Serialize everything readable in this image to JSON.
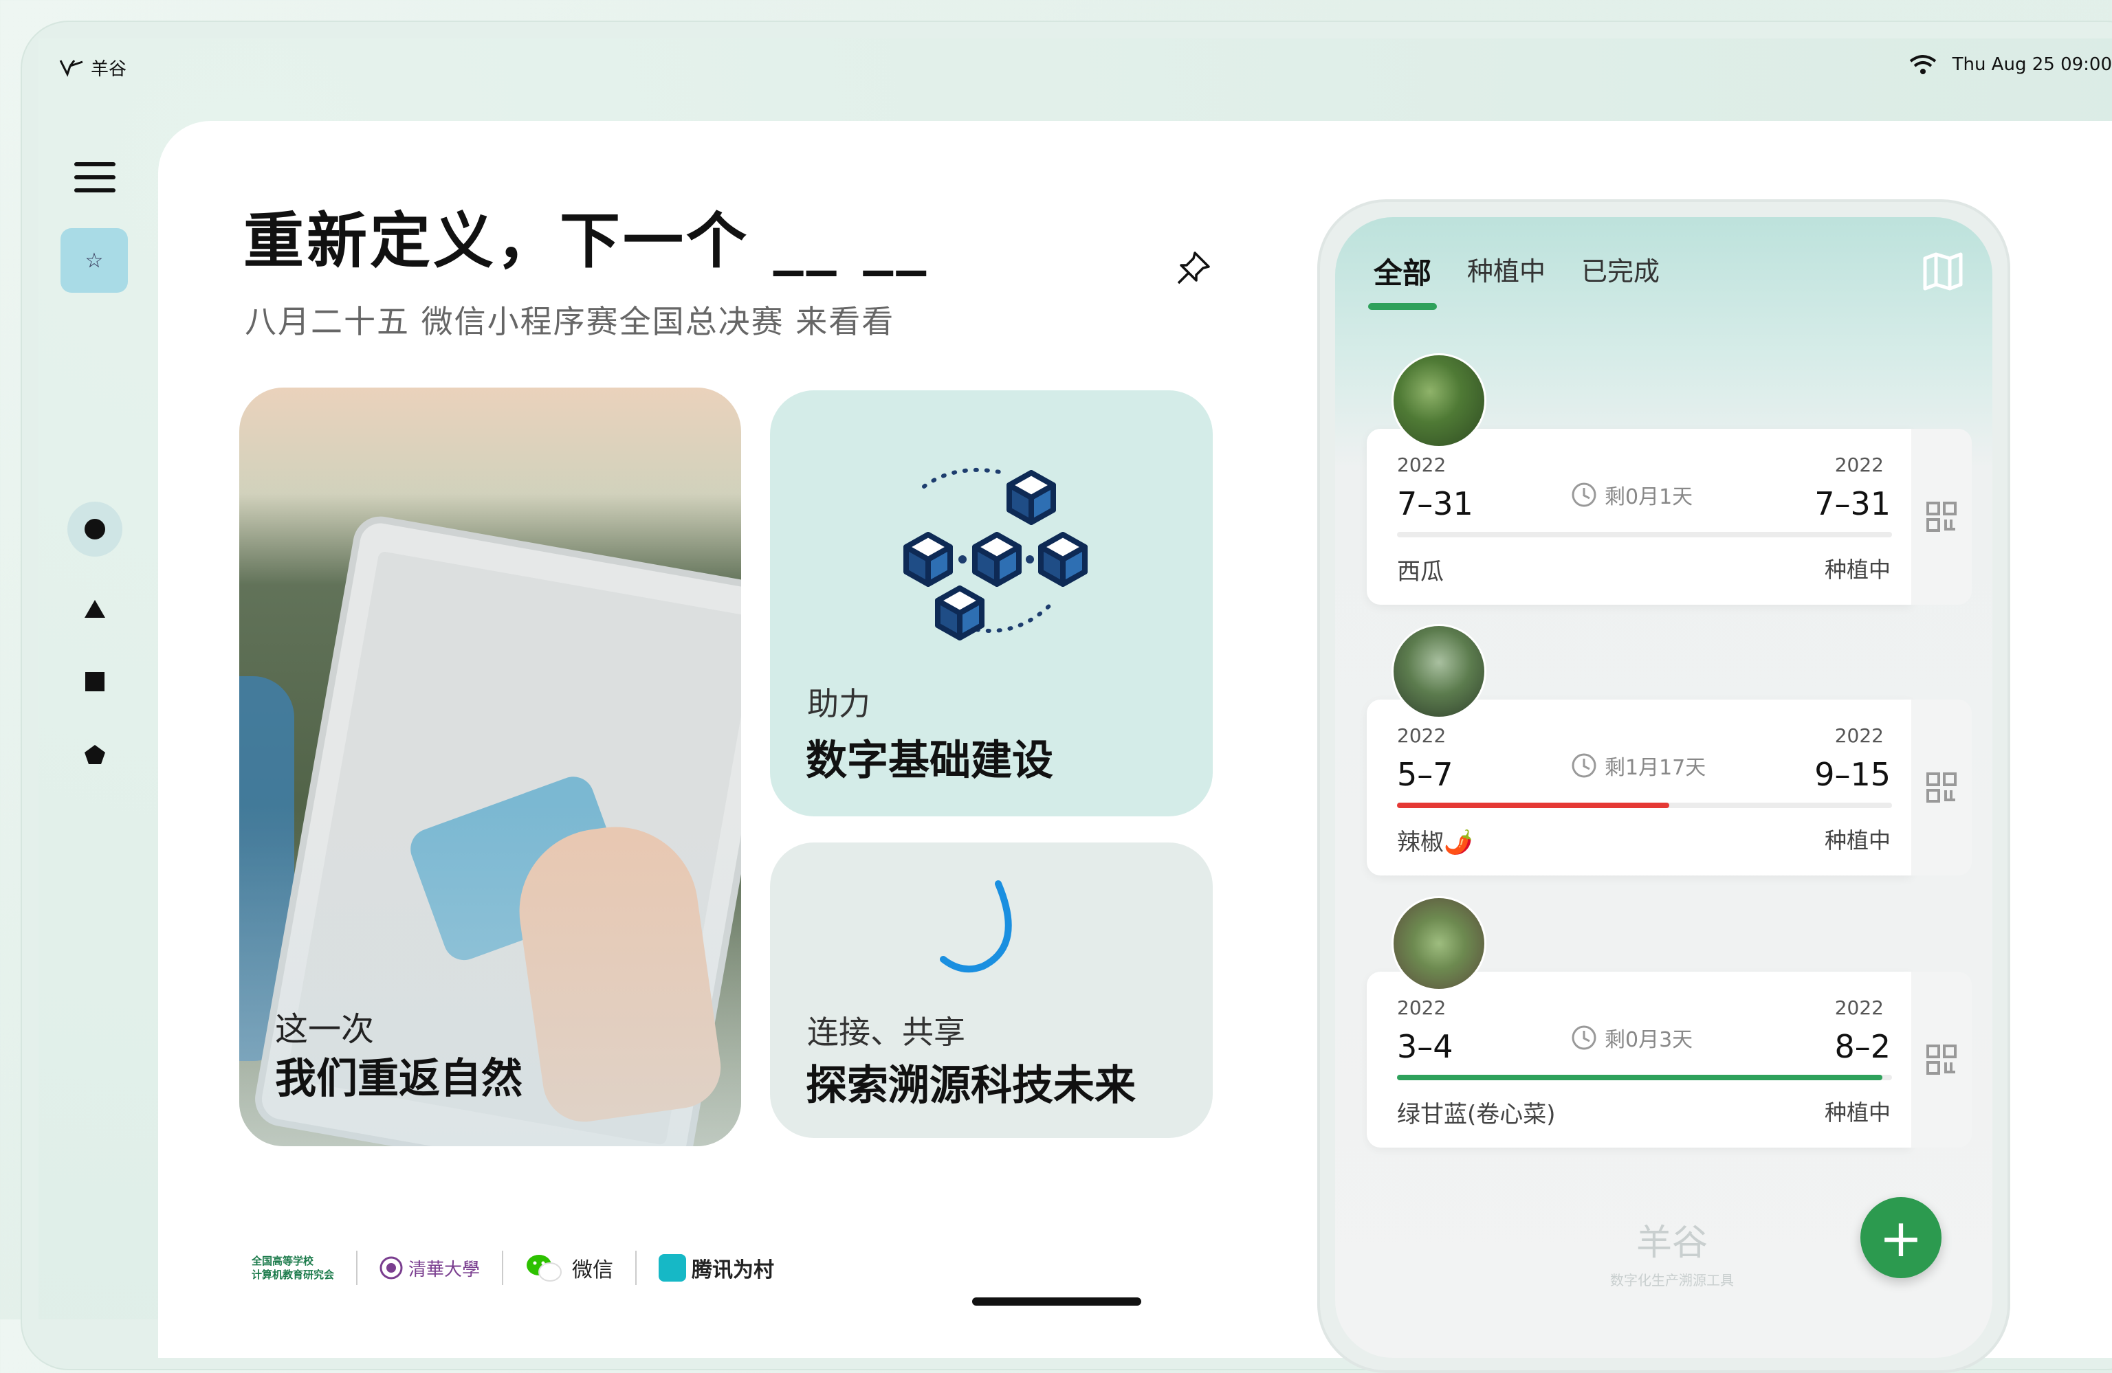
{
  "status_bar": {
    "app_name": "羊谷",
    "datetime": "Thu Aug 25 09:00"
  },
  "hero": {
    "headline": "重新定义，下一个 __ __",
    "subline": "八月二十五 微信小程序赛全国总决赛 来看看"
  },
  "cards": {
    "photo": {
      "line1": "这一次",
      "line2": "我们重返自然"
    },
    "blocks": {
      "line1": "助力",
      "line2": "数字基础建设"
    },
    "trace": {
      "line1": "连接、共享",
      "line2": "探索溯源科技未来"
    }
  },
  "partners": [
    {
      "name": "全国高等学校\n计算机教育研究会"
    },
    {
      "name": "清華大學"
    },
    {
      "name": "微信"
    },
    {
      "name": "腾讯为村"
    }
  ],
  "phone": {
    "tabs": [
      "全部",
      "种植中",
      "已完成"
    ],
    "active_tab": "全部",
    "records": [
      {
        "start_year": "2022",
        "start_date": "7–31",
        "remaining": "剩0月1天",
        "end_year": "2022",
        "end_date": "7–31",
        "crop": "西瓜",
        "status": "种植中",
        "progress": 0,
        "progress_color": "#e53935"
      },
      {
        "start_year": "2022",
        "start_date": "5–7",
        "remaining": "剩1月17天",
        "end_year": "2022",
        "end_date": "9–15",
        "crop": "辣椒🌶️",
        "status": "种植中",
        "progress": 0.55,
        "progress_color": "#e53935"
      },
      {
        "start_year": "2022",
        "start_date": "3–4",
        "remaining": "剩0月3天",
        "end_year": "2022",
        "end_date": "8–2",
        "crop": "绿甘蓝(卷心菜)",
        "status": "种植中",
        "progress": 0.98,
        "progress_color": "#2ea15b"
      }
    ],
    "watermark_title": "羊谷",
    "watermark_subtitle": "数字化生产溯源工具",
    "fab_label": "+"
  },
  "colors": {
    "accent_green": "#2c9a4f",
    "card_teal": "#d4ece8",
    "nav_active": "#a9dbe6"
  }
}
